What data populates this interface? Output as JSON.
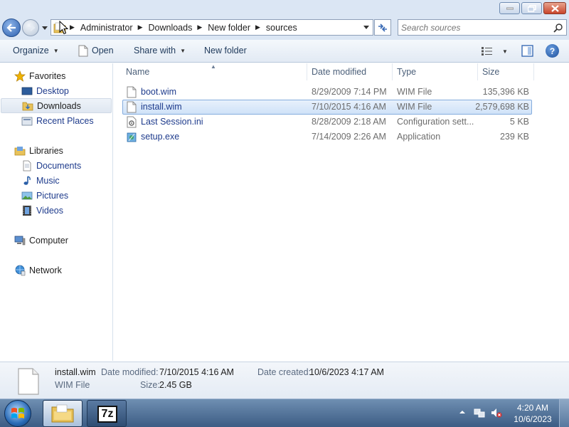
{
  "address": {
    "crumbs": [
      "Administrator",
      "Downloads",
      "New folder",
      "sources"
    ]
  },
  "search": {
    "placeholder": "Search sources"
  },
  "toolbar": {
    "organize_label": "Organize",
    "open_label": "Open",
    "share_label": "Share with",
    "new_folder_label": "New folder"
  },
  "nav": {
    "favorites": "Favorites",
    "desktop": "Desktop",
    "downloads": "Downloads",
    "recent": "Recent Places",
    "libraries": "Libraries",
    "documents": "Documents",
    "music": "Music",
    "pictures": "Pictures",
    "videos": "Videos",
    "computer": "Computer",
    "network": "Network",
    "selected": "Downloads"
  },
  "columns": {
    "name": "Name",
    "date": "Date modified",
    "type": "Type",
    "size": "Size"
  },
  "files": [
    {
      "name": "boot.wim",
      "date": "8/29/2009 7:14 PM",
      "type": "WIM File",
      "size": "135,396 KB",
      "icon": "document-icon"
    },
    {
      "name": "install.wim",
      "date": "7/10/2015 4:16 AM",
      "type": "WIM File",
      "size": "2,579,698 KB",
      "icon": "document-icon",
      "selected": true
    },
    {
      "name": "Last Session.ini",
      "date": "8/28/2009 2:18 AM",
      "type": "Configuration sett...",
      "size": "5 KB",
      "icon": "config-file-icon"
    },
    {
      "name": "setup.exe",
      "date": "7/14/2009 2:26 AM",
      "type": "Application",
      "size": "239 KB",
      "icon": "application-icon"
    }
  ],
  "details": {
    "name": "install.wim",
    "type": "WIM File",
    "modified_label": "Date modified:",
    "modified_value": "7/10/2015 4:16 AM",
    "created_label": "Date created:",
    "created_value": "10/6/2023 4:17 AM",
    "size_label": "Size:",
    "size_value": "2.45 GB"
  },
  "taskbar": {
    "sevenzip_label": "7z",
    "time": "4:20 AM",
    "date": "10/6/2023"
  },
  "colors": {
    "accent": "#1e3b8c",
    "selection": "#cfe2f8",
    "taskbar": "#3c5c84"
  }
}
